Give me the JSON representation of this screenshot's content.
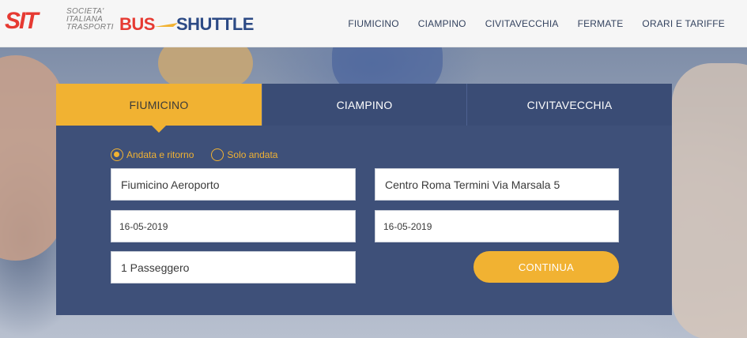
{
  "brand": {
    "sit_mark": "SIT",
    "sit_lines": [
      "SOCIETA'",
      "ITALIANA",
      "TRASPORTI"
    ],
    "bus": "BUS",
    "shuttle": "SHUTTLE",
    "colors": {
      "red": "#e63a32",
      "blue": "#2c4a85",
      "accent": "#f1b232",
      "panel": "#3e5079"
    }
  },
  "nav": {
    "items": [
      "FIUMICINO",
      "CIAMPINO",
      "CIVITAVECCHIA",
      "FERMATE",
      "ORARI E TARIFFE"
    ]
  },
  "booking": {
    "tabs": [
      {
        "label": "FIUMICINO",
        "active": true
      },
      {
        "label": "CIAMPINO",
        "active": false
      },
      {
        "label": "CIVITAVECCHIA",
        "active": false
      }
    ],
    "trip_type": {
      "options": [
        "Andata e ritorno",
        "Solo andata"
      ],
      "selected": "Andata e ritorno"
    },
    "from": "Fiumicino Aeroporto",
    "to": "Centro Roma Termini Via Marsala 5",
    "date_outbound": "16-05-2019",
    "date_return": "16-05-2019",
    "passengers": "1 Passeggero",
    "submit_label": "CONTINUA"
  }
}
